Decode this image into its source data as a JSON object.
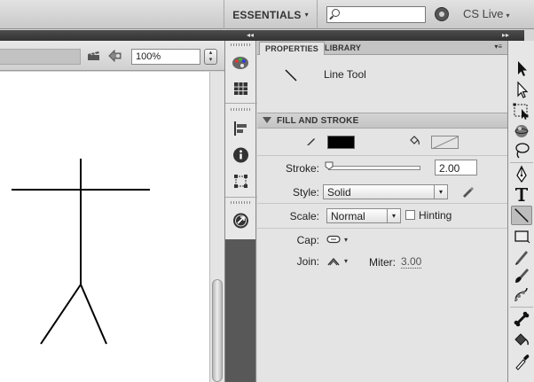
{
  "topbar": {
    "workspace_label": "ESSENTIALS",
    "workspace_caret": "▾",
    "search_value": "",
    "cs_live_label": "CS Live",
    "cs_live_caret": "▾"
  },
  "edit_bar": {
    "zoom_value": "100%"
  },
  "dock": {
    "collapse_left_glyph": "◂◂",
    "collapse_right_glyph": "▸▸"
  },
  "properties": {
    "tabs": [
      {
        "label": "PROPERTIES",
        "active": true
      },
      {
        "label": "LIBRARY",
        "active": false
      }
    ],
    "panel_menu_glyph": "▾≡",
    "tool_name": "Line Tool",
    "section_title": "FILL AND STROKE",
    "stroke_color": "#000000",
    "stroke_label": "Stroke:",
    "stroke_value": "2.00",
    "stroke_slider_fraction": 0.0,
    "style_label": "Style:",
    "style_value": "Solid",
    "scale_label": "Scale:",
    "scale_value": "Normal",
    "hinting_label": "Hinting",
    "hinting_checked": false,
    "cap_label": "Cap:",
    "join_label": "Join:",
    "miter_label": "Miter:",
    "miter_value": "3.00",
    "dropdown_glyph": "▾"
  },
  "tools": {
    "selected": "line-tool",
    "items": [
      "selection-tool",
      "subselection-tool",
      "free-transform-tool",
      "3d-rotation-tool",
      "lasso-tool",
      "pen-tool",
      "text-tool",
      "line-tool",
      "rectangle-tool",
      "pencil-tool",
      "brush-tool",
      "deco-tool",
      "bone-tool",
      "paint-bucket-tool",
      "eyedropper-tool"
    ]
  },
  "canvas": {
    "background": "#ffffff",
    "drawing": "stick-figure"
  }
}
